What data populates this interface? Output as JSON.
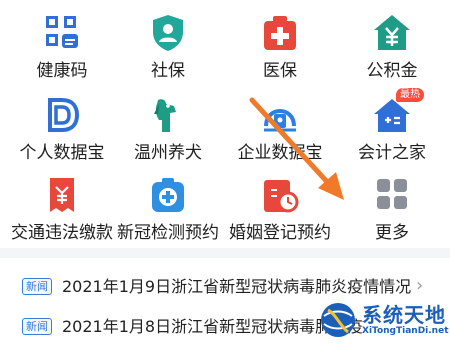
{
  "services": [
    {
      "label": "健康码",
      "icon": "health-code-icon",
      "color": "#2f6fd6"
    },
    {
      "label": "社保",
      "icon": "social-security-shield-icon",
      "color": "#21a89a"
    },
    {
      "label": "医保",
      "icon": "medical-insurance-icon",
      "color": "#e8483c"
    },
    {
      "label": "公积金",
      "icon": "housing-fund-icon",
      "color": "#1e9c86"
    },
    {
      "label": "个人数据宝",
      "icon": "personal-data-icon",
      "color": "#2f6fd6"
    },
    {
      "label": "温州养犬",
      "icon": "dog-icon",
      "color": "#1e9c86"
    },
    {
      "label": "企业数据宝",
      "icon": "enterprise-data-icon",
      "color": "#2f7fe0"
    },
    {
      "label": "会计之家",
      "icon": "accounting-home-icon",
      "color": "#2f6fd6",
      "badge": "最热"
    },
    {
      "label": "交通违法缴款",
      "icon": "traffic-fine-icon",
      "color": "#e8483c"
    },
    {
      "label": "新冠检测预约",
      "icon": "covid-test-icon",
      "color": "#2f8fe0"
    },
    {
      "label": "婚姻登记预约",
      "icon": "marriage-registration-icon",
      "color": "#e8483c"
    },
    {
      "label": "更多",
      "icon": "more-grid-icon",
      "color": "#8a8f99"
    }
  ],
  "news": [
    {
      "tag": "新闻",
      "text": "2021年1月9日浙江省新型冠状病毒肺炎疫情情况"
    },
    {
      "tag": "新闻",
      "text": "2021年1月8日浙江省新型冠状病毒肺炎疫"
    }
  ],
  "watermark": {
    "cn": "系统天地",
    "en": "XiTongTianDi.net"
  },
  "colors": {
    "arrow": "#f07a2a",
    "accent": "#2f6fd6"
  }
}
